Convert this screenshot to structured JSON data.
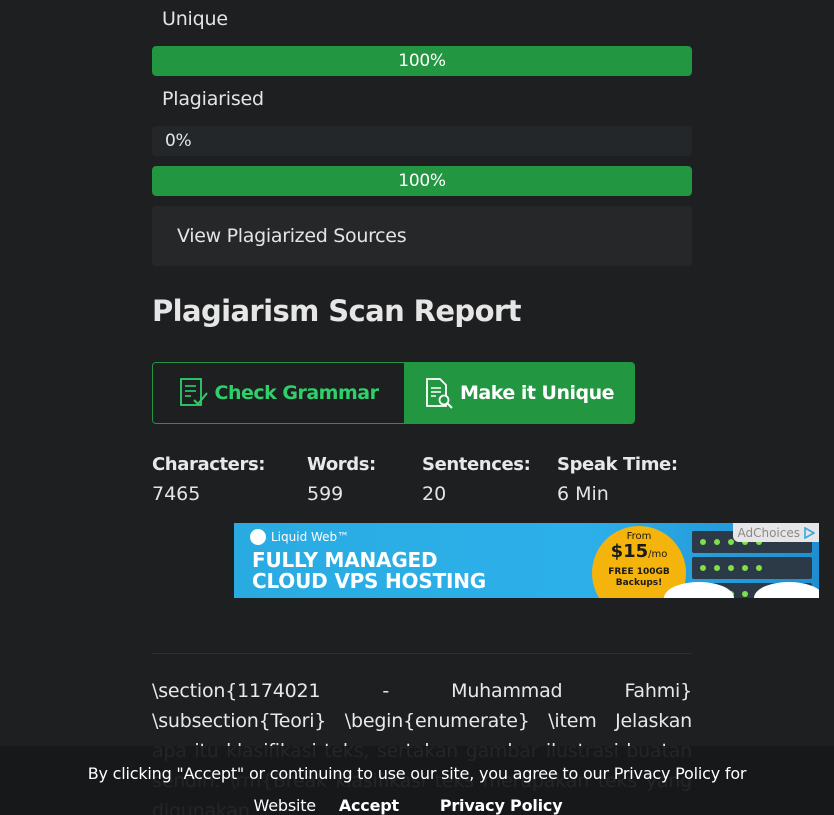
{
  "scores": {
    "unique_label": "Unique",
    "unique_value": "100%",
    "unique_fraction": 1.0,
    "plagiarised_label": "Plagiarised",
    "plagiarised_value": "0%",
    "plagiarised_fraction": 0.0,
    "total_value": "100%",
    "total_fraction": 1.0,
    "sources_button": "View Plagiarized Sources"
  },
  "report": {
    "title": "Plagiarism Scan Report",
    "check_grammar_label": "Check Grammar",
    "make_unique_label": "Make it Unique",
    "accent_color": "#239641"
  },
  "stats": {
    "characters_label": "Characters:",
    "characters_value": "7465",
    "words_label": "Words:",
    "words_value": "599",
    "sentences_label": "Sentences:",
    "sentences_value": "20",
    "speak_label": "Speak Time:",
    "speak_value": "6 Min"
  },
  "ad": {
    "brand": "Liquid Web™",
    "headline_line1": "FULLY MANAGED",
    "headline_line2": "CLOUD VPS HOSTING",
    "from": "From",
    "price": "$15",
    "per": "/mo",
    "offer_line1": "FREE 100GB",
    "offer_line2": "Backups!",
    "adchoices": "AdChoices"
  },
  "content": {
    "text": "\\section{1174021 - Muhammad Fahmi} \\subsection{Teori} \\begin{enumerate} \\item Jelaskan apa itu klasifikasi teks, sertakan gambar ilustrasi buatan sendiri. \\rm{Break klasifikasi teks merupakan teks yang digunakan"
  },
  "cookie": {
    "message": "By clicking \"Accept\" or continuing to use our site, you agree to our Privacy Policy for Website",
    "message_part1": "By clicking \"Accept\" or continuing to use our site, you agree to our Privacy Policy for",
    "website": "Website",
    "accept": "Accept",
    "privacy": "Privacy Policy"
  }
}
